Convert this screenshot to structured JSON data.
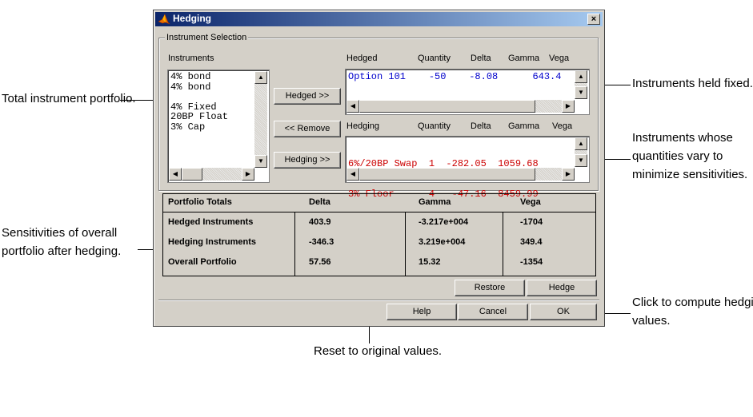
{
  "dialog": {
    "title": "Hedging",
    "close_label": "×"
  },
  "instrument_selection": {
    "group_label": "Instrument Selection",
    "instruments_header": "Instruments",
    "instruments": [
      "4% bond",
      "4% bond",
      "",
      "4% Fixed",
      "20BP Float",
      "3% Cap"
    ],
    "hedged_columns": [
      "Hedged",
      "Quantity",
      "Delta",
      "Gamma",
      "Vega"
    ],
    "hedged_rows": [
      {
        "text": "Option 101    -50    -8.08      643.4"
      }
    ],
    "hedging_columns": [
      "Hedging",
      "Quantity",
      "Delta",
      "Gamma",
      "Vega"
    ],
    "hedging_rows": [
      {
        "text": "6%/20BP Swap  1  -282.05  1059.68"
      },
      {
        "text": "3% Floor      4   -47.16  8459.99"
      }
    ],
    "buttons": {
      "hedged": "Hedged >>",
      "remove": "<< Remove",
      "hedging": "Hedging >>"
    }
  },
  "portfolio_totals": {
    "headers": [
      "Portfolio Totals",
      "Delta",
      "Gamma",
      "Vega"
    ],
    "rows": [
      {
        "label": "Hedged Instruments",
        "delta": "403.9",
        "gamma": "-3.217e+004",
        "vega": "-1704"
      },
      {
        "label": "Hedging Instruments",
        "delta": "-346.3",
        "gamma": "3.219e+004",
        "vega": "349.4"
      },
      {
        "label": "Overall Portfolio",
        "delta": "57.56",
        "gamma": "15.32",
        "vega": "-1354"
      }
    ]
  },
  "action_buttons": {
    "restore": "Restore",
    "hedge": "Hedge",
    "help": "Help",
    "cancel": "Cancel",
    "ok": "OK"
  },
  "callouts": {
    "total_portfolio": "Total instrument portfolio.",
    "held_fixed": "Instruments held fixed.",
    "vary_1": "Instruments whose",
    "vary_2": "quantities vary to",
    "vary_3": "minimize sensitivities.",
    "sens_1": "Sensitivities of overall",
    "sens_2": "portfolio after hedging.",
    "compute_1": "Click to compute hedging",
    "compute_2": "values.",
    "reset": "Reset to original values."
  },
  "colors": {
    "hedged_text": "#0000cc",
    "hedging_text": "#cc0000",
    "title_bar": "#0a246a"
  }
}
